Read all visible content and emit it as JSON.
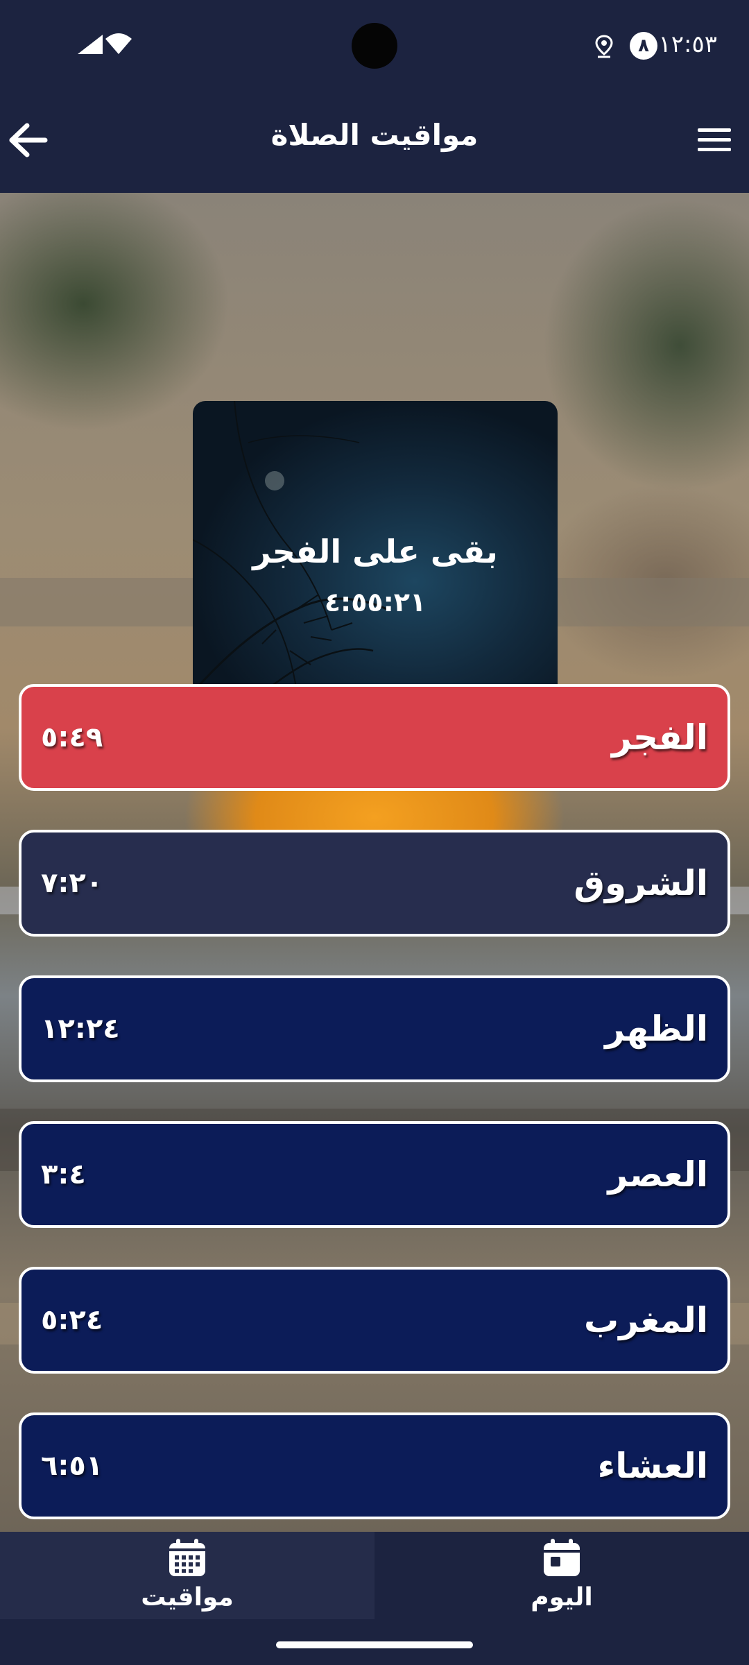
{
  "status_bar": {
    "time": "١٢:٥٣",
    "notification_badge": "٨",
    "icons": [
      "signal-icon",
      "wifi-icon",
      "location-icon"
    ]
  },
  "app_bar": {
    "title": "مواقيت الصلاة",
    "back_icon": "arrow-back-icon",
    "menu_icon": "hamburger-menu-icon"
  },
  "countdown": {
    "label": "بقى على  الفجر",
    "time": "٤:٥٥:٢١"
  },
  "prayers": [
    {
      "name": "الفجر",
      "time": "٥:٤٩",
      "color": "#d9414b",
      "highlighted": true
    },
    {
      "name": "الشروق",
      "time": "٧:٢٠",
      "color": "#272d4e",
      "highlighted": false
    },
    {
      "name": "الظهر",
      "time": "١٢:٢٤",
      "color": "#0c1c58",
      "highlighted": false
    },
    {
      "name": "العصر",
      "time": "٣:٤",
      "color": "#0c1c58",
      "highlighted": false
    },
    {
      "name": "المغرب",
      "time": "٥:٢٤",
      "color": "#0c1c58",
      "highlighted": false
    },
    {
      "name": "العشاء",
      "time": "٦:٥١",
      "color": "#0c1c58",
      "highlighted": false
    }
  ],
  "bottom_nav": {
    "items": [
      {
        "label": "مواقيت",
        "icon": "calendar-grid-icon",
        "active": false
      },
      {
        "label": "اليوم",
        "icon": "calendar-today-icon",
        "active": true
      }
    ]
  },
  "colors": {
    "app_bar": "#1c2340",
    "highlight": "#d9414b",
    "row_default": "#0c1c58"
  }
}
